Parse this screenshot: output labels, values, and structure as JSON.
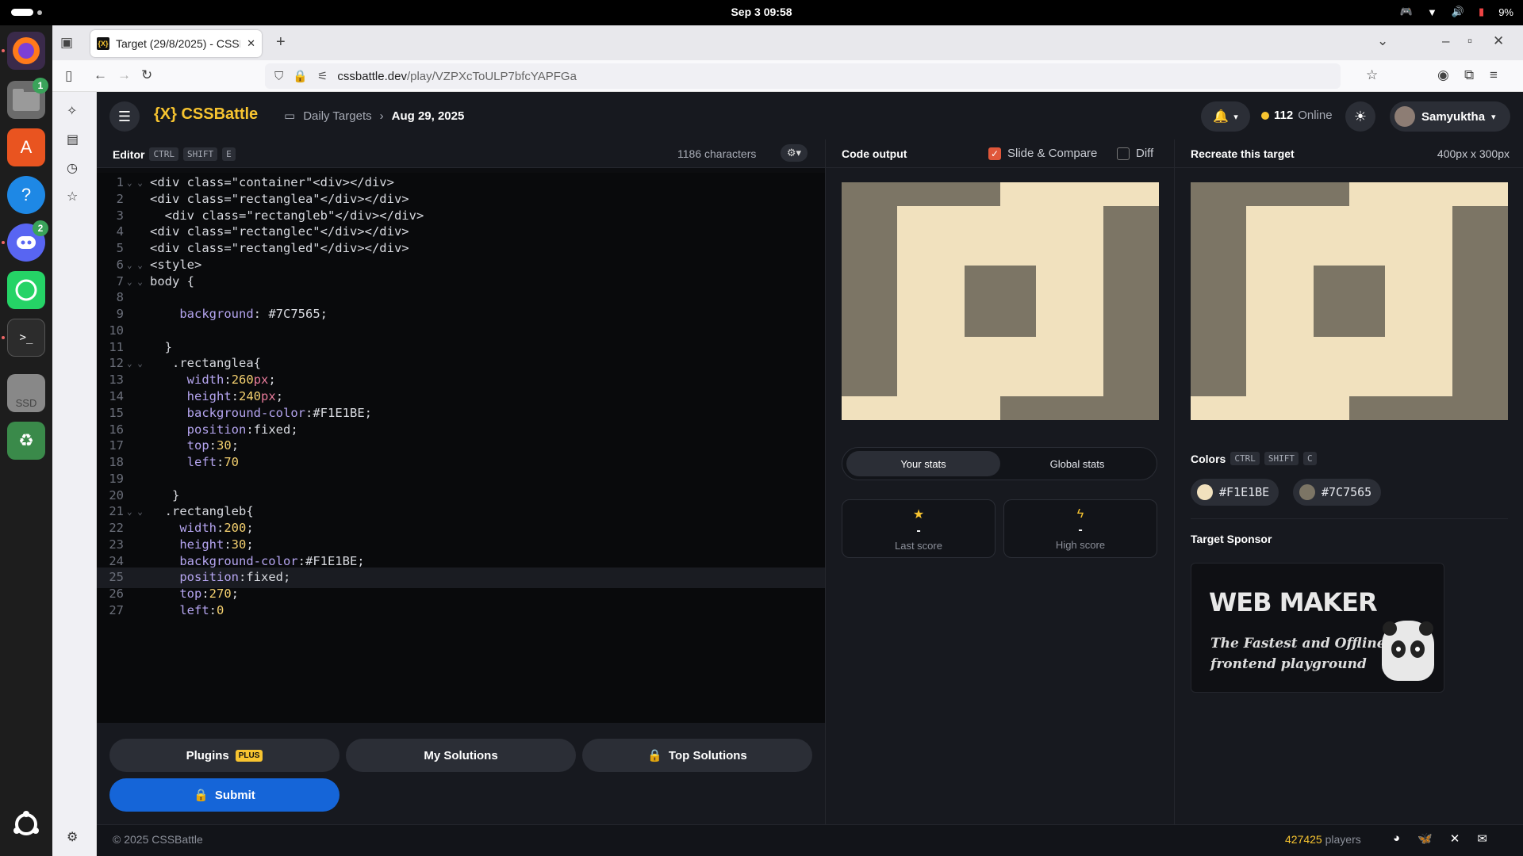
{
  "system": {
    "clock": "Sep 3  09:58",
    "battery": "9%"
  },
  "dock": {
    "files_badge": "1",
    "discord_badge": "2",
    "ssd_label": "SSD"
  },
  "browser": {
    "tab_title": "Target (29/8/2025) - CSSBattle",
    "url_host": "cssbattle.dev",
    "url_path": "/play/VZPXcToULP7bfcYAPFGa"
  },
  "header": {
    "logo": "{X} CSSBattle",
    "crumb_parent": "Daily Targets",
    "crumb_current": "Aug 29, 2025",
    "online_count": "112",
    "online_label": "Online",
    "username": "Samyuktha"
  },
  "editor": {
    "title": "Editor",
    "shortcut": [
      "CTRL",
      "SHIFT",
      "E"
    ],
    "char_count": "1186 characters",
    "active_line": 25
  },
  "code_lines": [
    "<div class=\"container\"<div></div>",
    "<div class=\"rectanglea\"</div></div>",
    "  <div class=\"rectangleb\"</div></div>",
    "<div class=\"rectanglec\"</div></div>",
    "<div class=\"rectangled\"</div></div>",
    "<style>",
    "body {",
    "",
    "    background: #7C7565;",
    "",
    "  }",
    "   .rectanglea{",
    "     width:260px;",
    "     height:240px;",
    "     background-color:#F1E1BE;",
    "     position:fixed;",
    "     top:30;",
    "     left:70",
    "",
    "   }",
    "  .rectangleb{",
    "    width:200;",
    "    height:30;",
    "    background-color:#F1E1BE;",
    "    position:fixed;",
    "    top:270;",
    "    left:0"
  ],
  "actions": {
    "plugins": "Plugins",
    "plugins_badge": "PLUS",
    "my_solutions": "My Solutions",
    "top_solutions": "Top Solutions",
    "submit": "Submit"
  },
  "output": {
    "title": "Code output",
    "slide_compare": "Slide & Compare",
    "slide_compare_checked": true,
    "diff": "Diff",
    "diff_checked": false
  },
  "stats": {
    "tab_your": "Your stats",
    "tab_global": "Global stats",
    "last_score_value": "-",
    "last_score_label": "Last score",
    "high_score_value": "-",
    "high_score_label": "High score"
  },
  "target": {
    "title": "Recreate this target",
    "size": "400px x 300px",
    "colors_label": "Colors",
    "colors_shortcut": [
      "CTRL",
      "SHIFT",
      "C"
    ],
    "colors": [
      {
        "hex": "#F1E1BE",
        "label": "#F1E1BE"
      },
      {
        "hex": "#7C7565",
        "label": "#7C7565"
      }
    ],
    "sponsor_label": "Target Sponsor",
    "sponsor_name": "WEB MAKER",
    "sponsor_tagline": "The Fastest and Offline frontend playground"
  },
  "footer": {
    "copyright": "© 2025 CSSBattle",
    "players_count": "427425",
    "players_label": "players"
  },
  "colors": {
    "accent": "#f7c430",
    "submit": "#1565d8",
    "cream": "#F1E1BE",
    "taupe": "#7C7565"
  }
}
